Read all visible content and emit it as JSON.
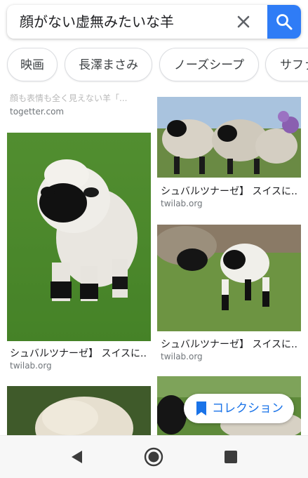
{
  "search": {
    "query": "顔がない虚無みたいな羊",
    "clear_icon": "close-icon",
    "submit_icon": "search-icon"
  },
  "chips": [
    "映画",
    "長澤まさみ",
    "ノーズシープ",
    "サファリ"
  ],
  "results": {
    "top_left": {
      "caption": "顔も表情も全く見えない羊「...",
      "source": "togetter.com"
    },
    "left_1": {
      "caption": "シュバルツナーゼ】 スイスに...",
      "source": "twilab.org"
    },
    "right_1": {
      "caption": "シュバルツナーゼ】 スイスに...",
      "source": "twilab.org"
    },
    "right_2": {
      "caption": "シュバルツナーゼ】 スイスに...",
      "source": "twilab.org"
    }
  },
  "collection": {
    "label": "コレクション",
    "icon": "bookmark-icon"
  },
  "nav": {
    "back_icon": "back-triangle-icon",
    "home_icon": "home-circle-icon",
    "recents_icon": "recents-square-icon"
  },
  "colors": {
    "accent": "#2f7cf6",
    "link": "#1a73e8"
  }
}
